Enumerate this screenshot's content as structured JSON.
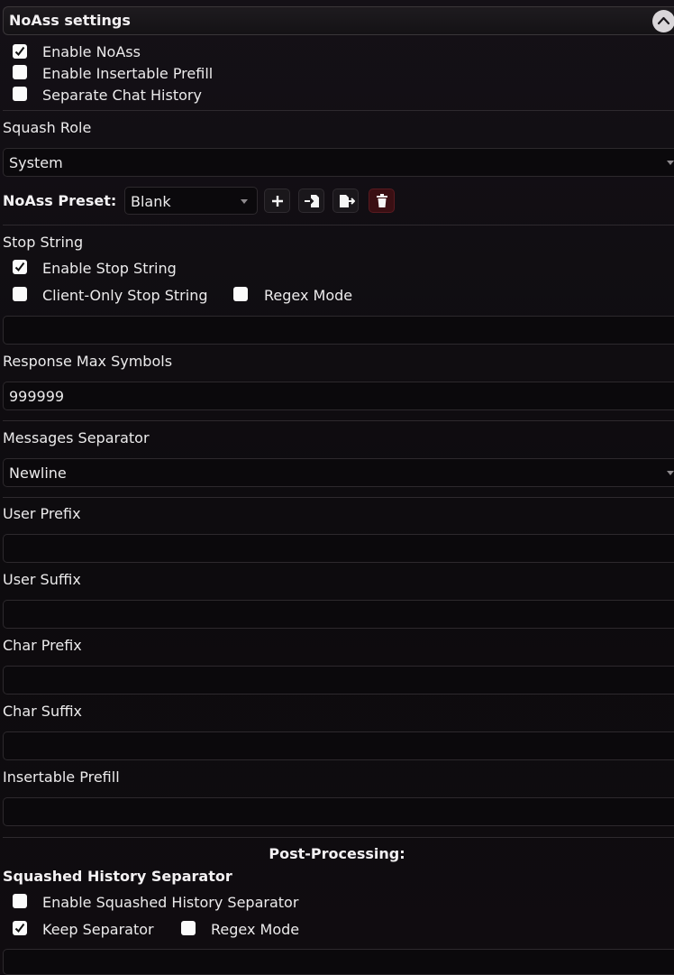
{
  "panel": {
    "title": "NoAss settings"
  },
  "options": {
    "enable_noass": {
      "label": "Enable NoAss",
      "checked": true
    },
    "enable_insertable_prefill": {
      "label": "Enable Insertable Prefill",
      "checked": false
    },
    "separate_chat_history": {
      "label": "Separate Chat History",
      "checked": false
    }
  },
  "squash_role": {
    "label": "Squash Role",
    "value": "System"
  },
  "preset": {
    "label": "NoAss Preset:",
    "value": "Blank",
    "actions": [
      "add-icon",
      "import-icon",
      "export-icon",
      "trash-icon"
    ]
  },
  "stop_string": {
    "label": "Stop String",
    "enable": {
      "label": "Enable Stop String",
      "checked": true
    },
    "client_only": {
      "label": "Client-Only Stop String",
      "checked": false
    },
    "regex": {
      "label": "Regex Mode",
      "checked": false
    },
    "value": ""
  },
  "response_max": {
    "label": "Response Max Symbols",
    "value": "999999"
  },
  "messages_separator": {
    "label": "Messages Separator",
    "value": "Newline"
  },
  "user_prefix": {
    "label": "User Prefix",
    "value": ""
  },
  "user_suffix": {
    "label": "User Suffix",
    "value": ""
  },
  "char_prefix": {
    "label": "Char Prefix",
    "value": ""
  },
  "char_suffix": {
    "label": "Char Suffix",
    "value": ""
  },
  "insertable_prefill": {
    "label": "Insertable Prefill",
    "value": ""
  },
  "post_processing": {
    "heading": "Post-Processing:",
    "squashed_label": "Squashed History Separator",
    "enable": {
      "label": "Enable Squashed History Separator",
      "checked": false
    },
    "keep": {
      "label": "Keep Separator",
      "checked": true
    },
    "regex": {
      "label": "Regex Mode",
      "checked": false
    },
    "value": ""
  },
  "colors": {
    "background": "#0d0b0e",
    "text": "#ecebec",
    "danger": "#3a0f13"
  }
}
